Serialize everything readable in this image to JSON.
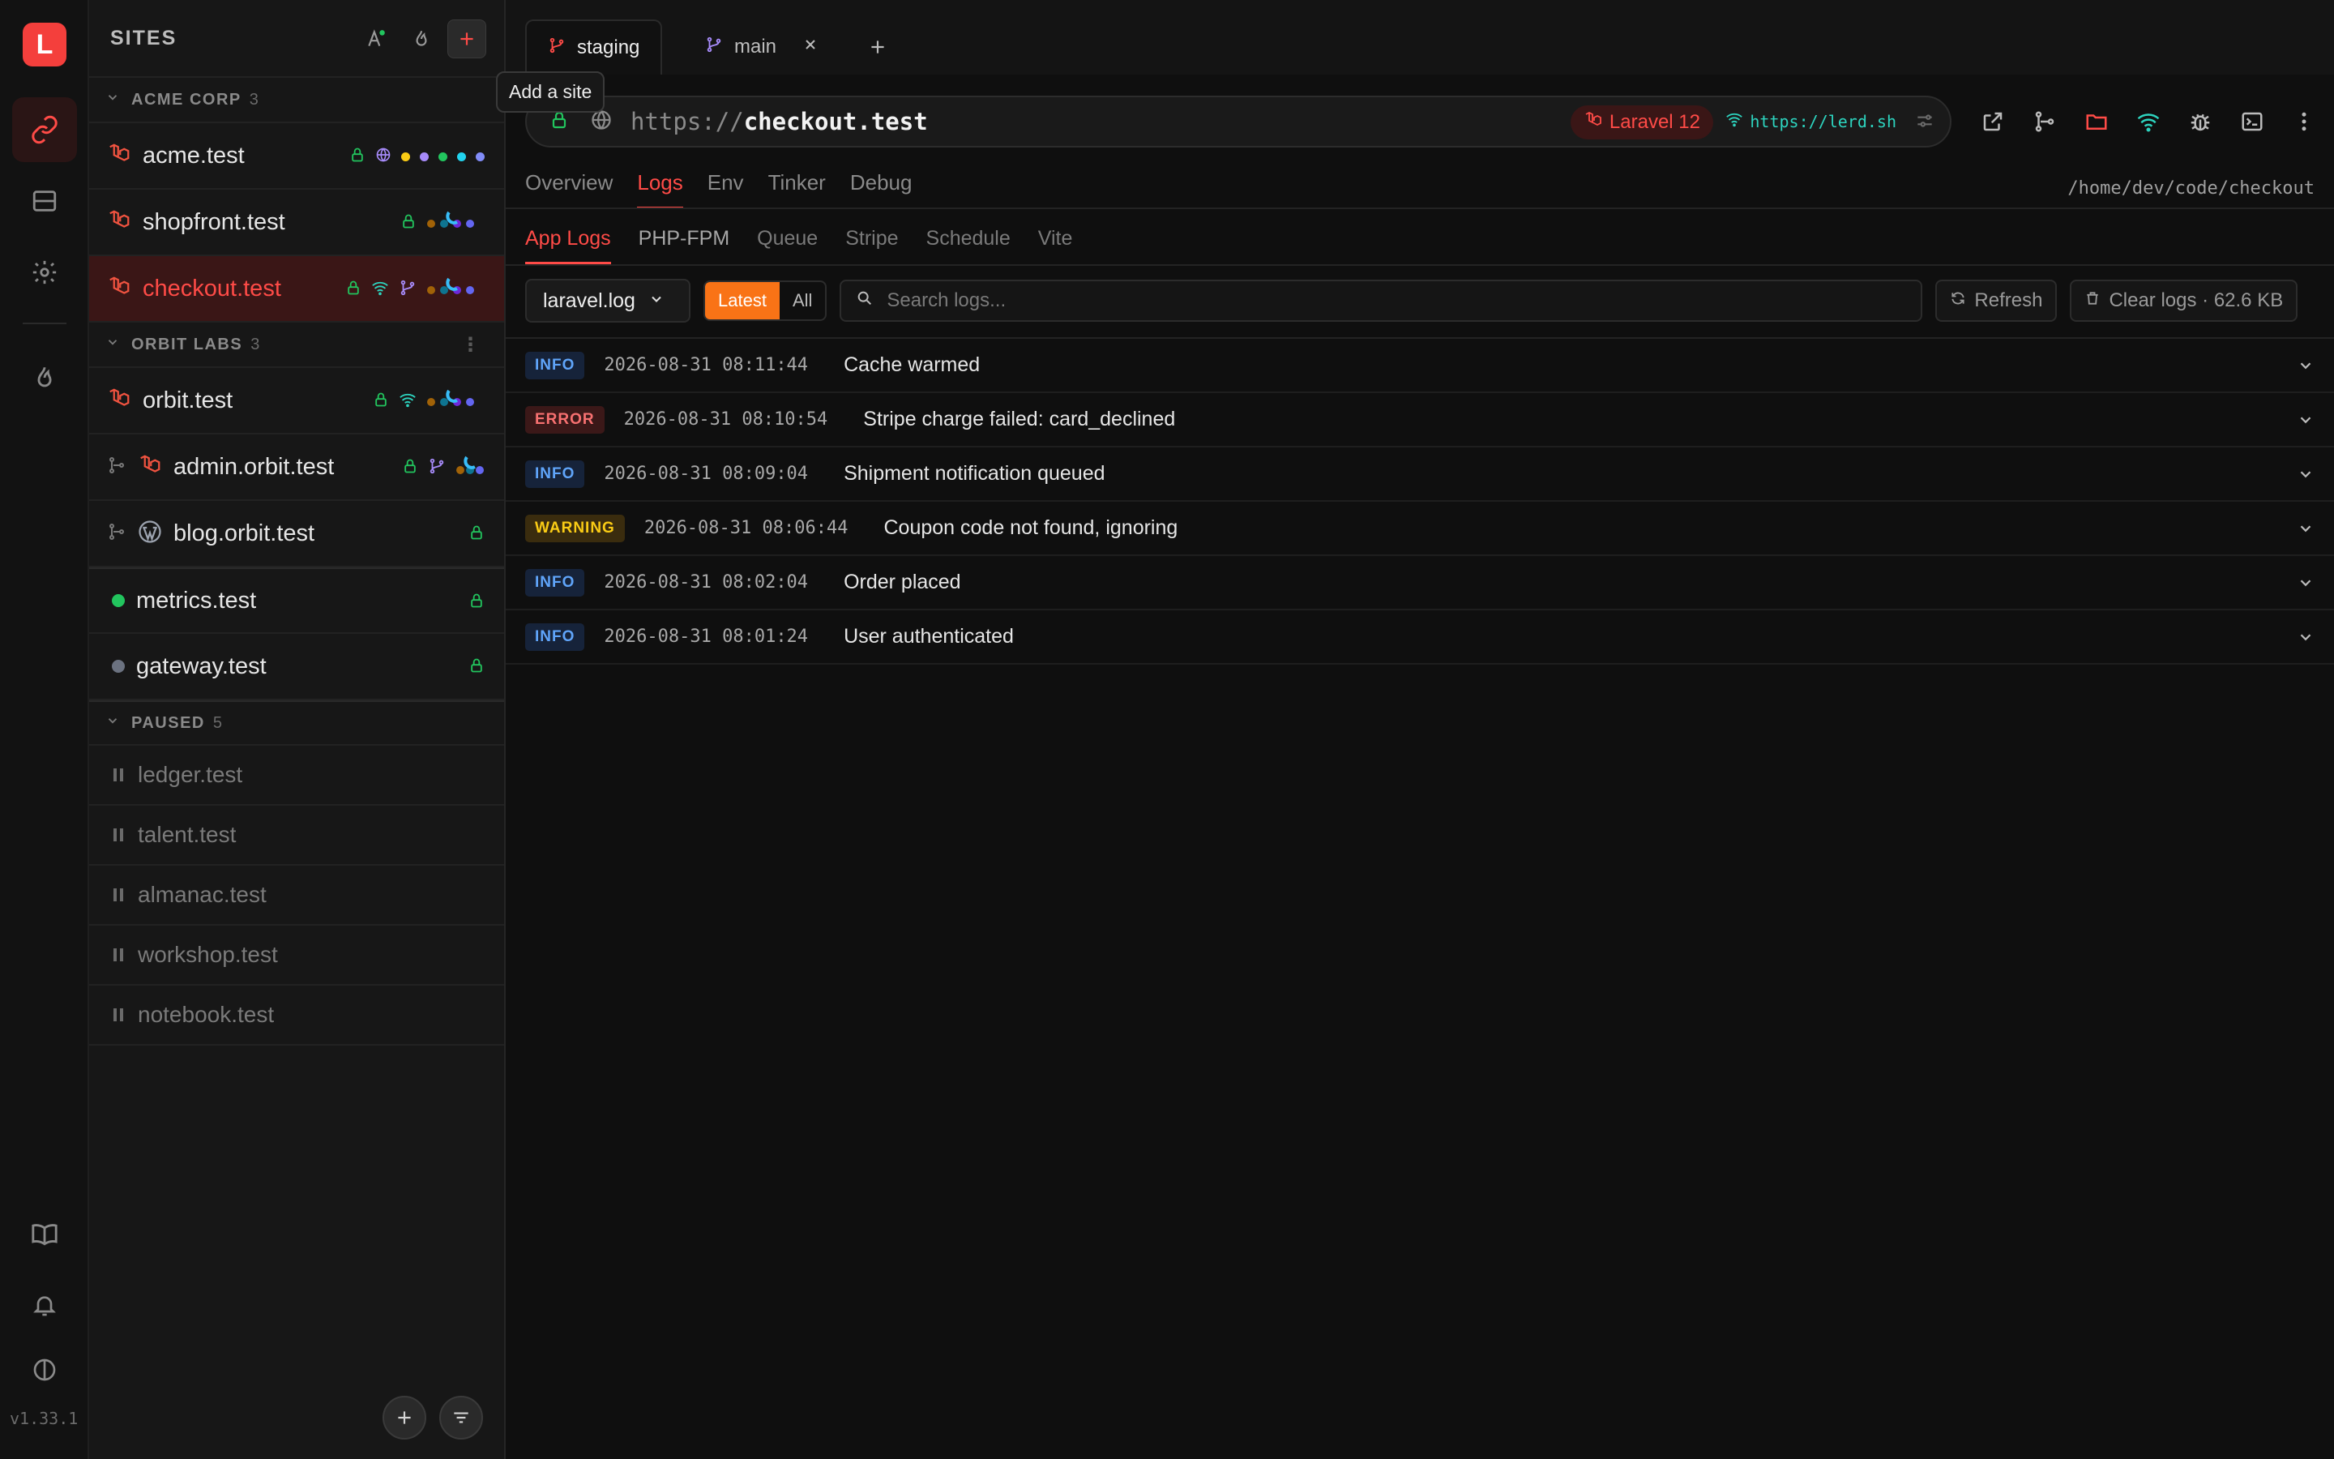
{
  "app": {
    "logo_letter": "L",
    "version": "v1.33.1"
  },
  "sidebar": {
    "title": "SITES",
    "tooltip": "Add a site",
    "groups": [
      {
        "label": "ACME CORP",
        "count": "3"
      },
      {
        "label": "ORBIT LABS",
        "count": "3"
      },
      {
        "label": "PAUSED",
        "count": "5"
      }
    ],
    "sites": {
      "acme": "acme.test",
      "shopfront": "shopfront.test",
      "checkout": "checkout.test",
      "orbit": "orbit.test",
      "admin_orbit": "admin.orbit.test",
      "blog_orbit": "blog.orbit.test",
      "metrics": "metrics.test",
      "gateway": "gateway.test"
    },
    "paused": [
      "ledger.test",
      "talent.test",
      "almanac.test",
      "workshop.test",
      "notebook.test"
    ]
  },
  "tabs": [
    {
      "label": "staging"
    },
    {
      "label": "main"
    }
  ],
  "url": {
    "scheme": "https://",
    "host": "checkout.test",
    "framework": "Laravel 12",
    "share_url": "https://lerd.sh"
  },
  "nav_tabs": [
    "Overview",
    "Logs",
    "Env",
    "Tinker",
    "Debug"
  ],
  "project_path": "/home/dev/code/checkout",
  "sub_tabs": [
    "App Logs",
    "PHP-FPM",
    "Queue",
    "Stripe",
    "Schedule",
    "Vite"
  ],
  "toolbar": {
    "log_file": "laravel.log",
    "latest": "Latest",
    "all": "All",
    "search_placeholder": "Search logs...",
    "refresh": "Refresh",
    "clear": "Clear logs · 62.6 KB"
  },
  "logs": [
    {
      "level": "INFO",
      "time": "2026-08-31 08:11:44",
      "message": "Cache warmed"
    },
    {
      "level": "ERROR",
      "time": "2026-08-31 08:10:54",
      "message": "Stripe charge failed: card_declined"
    },
    {
      "level": "INFO",
      "time": "2026-08-31 08:09:04",
      "message": "Shipment notification queued"
    },
    {
      "level": "WARNING",
      "time": "2026-08-31 08:06:44",
      "message": "Coupon code not found, ignoring"
    },
    {
      "level": "INFO",
      "time": "2026-08-31 08:02:04",
      "message": "Order placed"
    },
    {
      "level": "INFO",
      "time": "2026-08-31 08:01:24",
      "message": "User authenticated"
    }
  ],
  "colors": {
    "accent": "#ff4b47",
    "latest": "#f97316",
    "info": "#60a5fa",
    "error": "#f87171",
    "warning": "#facc15",
    "share": "#2dd4bf"
  }
}
